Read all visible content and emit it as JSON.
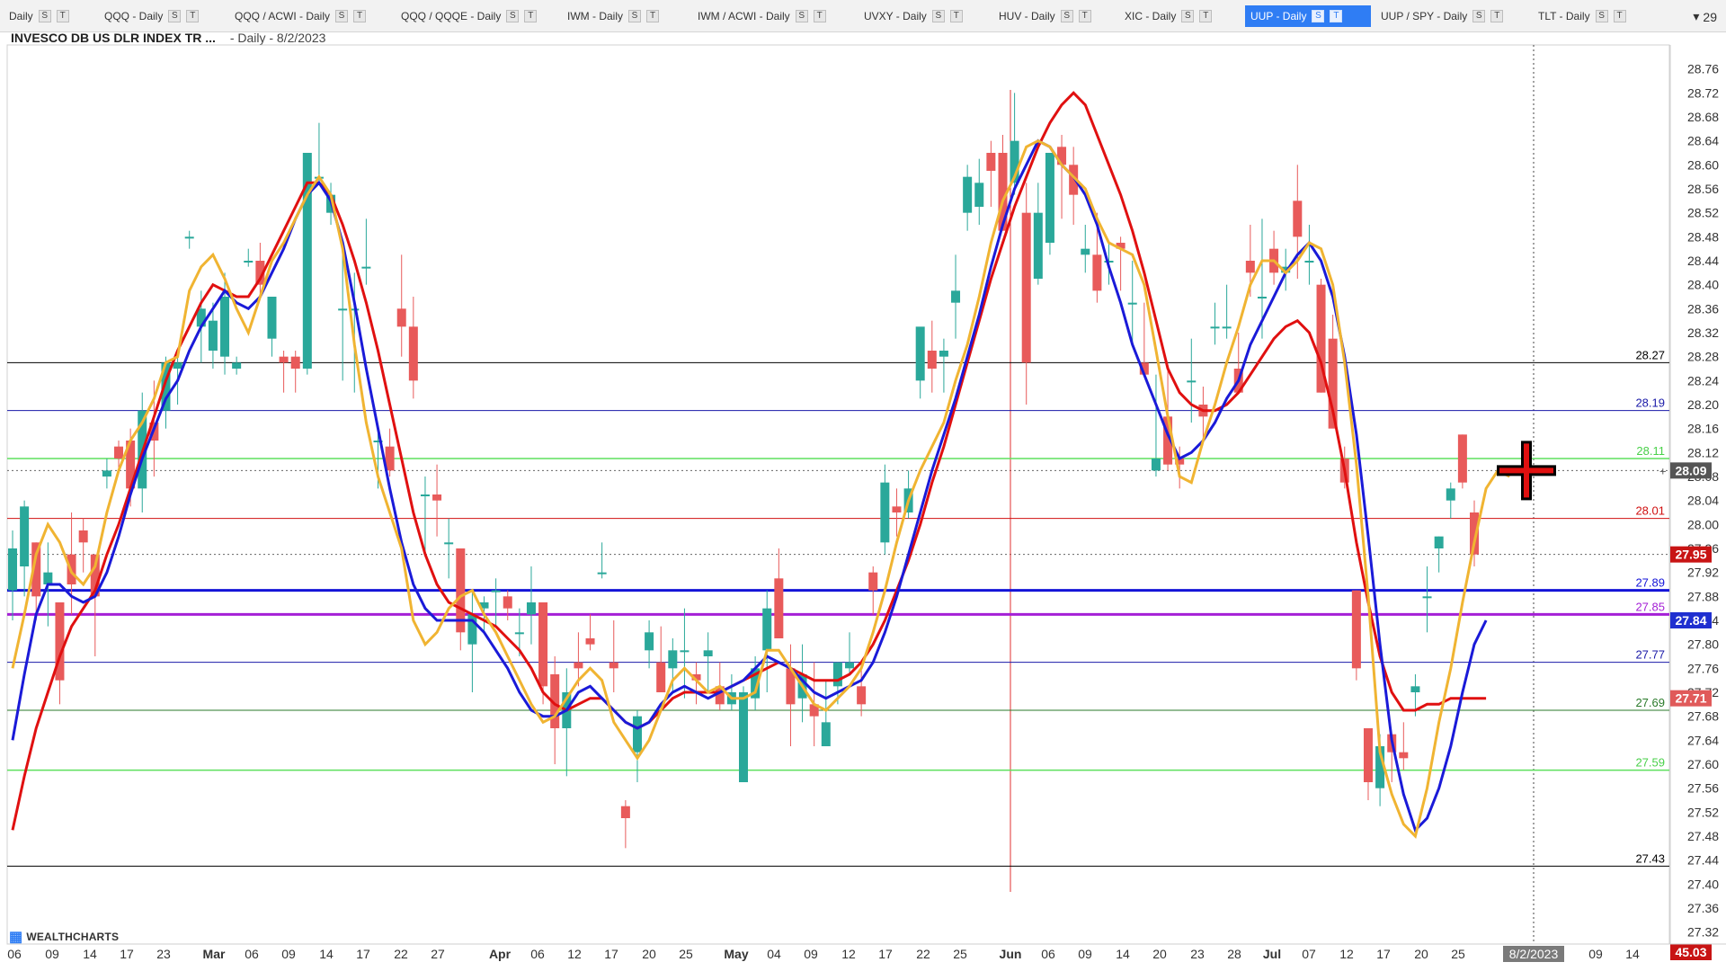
{
  "tabs": [
    {
      "label": "Daily",
      "active": false
    },
    {
      "label": "QQQ - Daily",
      "active": false
    },
    {
      "label": "QQQ / ACWI - Daily",
      "active": false
    },
    {
      "label": "QQQ / QQQE - Daily",
      "active": false
    },
    {
      "label": "IWM - Daily",
      "active": false
    },
    {
      "label": "IWM / ACWI - Daily",
      "active": false
    },
    {
      "label": "UVXY - Daily",
      "active": false
    },
    {
      "label": "HUV - Daily",
      "active": false
    },
    {
      "label": "XIC - Daily",
      "active": false
    },
    {
      "label": "UUP - Daily",
      "active": true
    },
    {
      "label": "UUP / SPY - Daily",
      "active": false
    },
    {
      "label": "TLT - Daily",
      "active": false
    }
  ],
  "tab_buttons": {
    "s": "S",
    "t": "T"
  },
  "tab_more": {
    "icon": "chevron-down-icon",
    "count": "29"
  },
  "title": {
    "symbol": "INVESCO DB US DLR INDEX TR ...",
    "subtitle": "- Daily - 8/2/2023"
  },
  "logo": {
    "text": "WEALTHCHARTS"
  },
  "price_axis": {
    "ticks": [
      "28.76",
      "28.72",
      "28.68",
      "28.64",
      "28.60",
      "28.56",
      "28.52",
      "28.48",
      "28.44",
      "28.40",
      "28.36",
      "28.32",
      "28.28",
      "28.24",
      "28.20",
      "28.16",
      "28.12",
      "28.08",
      "28.04",
      "28.00",
      "27.96",
      "27.92",
      "27.88",
      "27.84",
      "27.80",
      "27.76",
      "27.72",
      "27.68",
      "27.64",
      "27.60",
      "27.56",
      "27.52",
      "27.48",
      "27.44",
      "27.40",
      "27.36",
      "27.32"
    ],
    "badges": [
      {
        "value": "28.09",
        "color": "#555555"
      },
      {
        "value": "27.95",
        "color": "#c81414"
      },
      {
        "value": "27.84",
        "color": "#1f2fd0"
      },
      {
        "value": "27.71",
        "color": "#e05a5a"
      },
      {
        "value": "45.03",
        "color": "#c81414"
      }
    ]
  },
  "horizontal_lines": [
    {
      "label": "28.27",
      "value": 28.27,
      "color": "#000000",
      "width": 1
    },
    {
      "label": "28.19",
      "value": 28.19,
      "color": "#1a1aa8",
      "width": 1
    },
    {
      "label": "28.11",
      "value": 28.11,
      "color": "#5ee05e",
      "width": 1.5
    },
    {
      "label": "28.01",
      "value": 28.01,
      "color": "#d01010",
      "width": 1
    },
    {
      "label": "27.89",
      "value": 27.89,
      "color": "#1414d8",
      "width": 3
    },
    {
      "label": "27.85",
      "value": 27.85,
      "color": "#a41fd6",
      "width": 3
    },
    {
      "label": "27.77",
      "value": 27.77,
      "color": "#1a1aa8",
      "width": 1
    },
    {
      "label": "27.69",
      "value": 27.69,
      "color": "#2a7a2a",
      "width": 1
    },
    {
      "label": "27.59",
      "value": 27.59,
      "color": "#5ee05e",
      "width": 1.5
    },
    {
      "label": "27.43",
      "value": 27.43,
      "color": "#000000",
      "width": 1
    }
  ],
  "x_axis": {
    "labels": [
      "06",
      "09",
      "14",
      "17",
      "23",
      "Mar",
      "06",
      "09",
      "14",
      "17",
      "22",
      "27",
      "Apr",
      "06",
      "12",
      "17",
      "20",
      "25",
      "May",
      "04",
      "09",
      "12",
      "17",
      "22",
      "25",
      "Jun",
      "06",
      "09",
      "14",
      "20",
      "23",
      "28",
      "Jul",
      "07",
      "12",
      "17",
      "20",
      "25",
      "8/2/2023",
      "09",
      "14"
    ]
  },
  "chart_data": {
    "type": "candlestick",
    "ylim": [
      27.3,
      28.8
    ],
    "series_colors": {
      "up": "#2aa89a",
      "down": "#e85a5a",
      "ma_fast": "#f0b432",
      "ma_mid": "#1a1ad8",
      "ma_slow": "#e01010"
    },
    "candles": [
      [
        27.89,
        27.99,
        27.84,
        27.96
      ],
      [
        27.93,
        28.04,
        27.88,
        28.03
      ],
      [
        27.97,
        27.97,
        27.84,
        27.88
      ],
      [
        27.9,
        27.97,
        27.83,
        27.92
      ],
      [
        27.87,
        27.87,
        27.7,
        27.74
      ],
      [
        27.95,
        28.02,
        27.85,
        27.9
      ],
      [
        27.99,
        28.01,
        27.92,
        27.97
      ],
      [
        27.95,
        27.95,
        27.78,
        27.88
      ],
      [
        28.08,
        28.11,
        28.06,
        28.09
      ],
      [
        28.13,
        28.14,
        28.09,
        28.11
      ],
      [
        28.14,
        28.16,
        28.03,
        28.06
      ],
      [
        28.06,
        28.22,
        28.02,
        28.19
      ],
      [
        28.17,
        28.24,
        28.08,
        28.14
      ],
      [
        28.19,
        28.28,
        28.16,
        28.27
      ],
      [
        28.26,
        28.28,
        28.2,
        28.27
      ],
      [
        28.48,
        28.49,
        28.46,
        28.48
      ],
      [
        28.33,
        28.39,
        28.27,
        28.36
      ],
      [
        28.29,
        28.37,
        28.26,
        28.34
      ],
      [
        28.28,
        28.42,
        28.25,
        28.38
      ],
      [
        28.26,
        28.28,
        28.25,
        28.27
      ],
      [
        28.44,
        28.46,
        28.43,
        28.44
      ],
      [
        28.44,
        28.47,
        28.38,
        28.4
      ],
      [
        28.31,
        28.38,
        28.28,
        28.38
      ],
      [
        28.28,
        28.29,
        28.22,
        28.27
      ],
      [
        28.28,
        28.29,
        28.22,
        28.26
      ],
      [
        28.26,
        28.62,
        28.25,
        28.62
      ],
      [
        28.58,
        28.67,
        28.57,
        28.58
      ],
      [
        28.52,
        28.57,
        28.5,
        28.55
      ],
      [
        28.36,
        28.45,
        28.24,
        28.36
      ],
      [
        28.36,
        28.42,
        28.22,
        28.36
      ],
      [
        28.43,
        28.51,
        28.4,
        28.43
      ],
      [
        28.14,
        28.16,
        28.06,
        28.14
      ],
      [
        28.13,
        28.16,
        28.08,
        28.09
      ],
      [
        28.36,
        28.45,
        28.28,
        28.33
      ],
      [
        28.33,
        28.38,
        28.21,
        28.24
      ],
      [
        28.05,
        28.08,
        27.95,
        28.05
      ],
      [
        28.05,
        28.1,
        27.98,
        28.04
      ],
      [
        27.97,
        28.01,
        27.91,
        27.97
      ],
      [
        27.96,
        27.96,
        27.79,
        27.82
      ],
      [
        27.8,
        27.89,
        27.72,
        27.85
      ],
      [
        27.86,
        27.88,
        27.82,
        27.87
      ],
      [
        27.89,
        27.91,
        27.83,
        27.89
      ],
      [
        27.88,
        27.89,
        27.84,
        27.86
      ],
      [
        27.82,
        27.86,
        27.78,
        27.82
      ],
      [
        27.85,
        27.93,
        27.8,
        27.87
      ],
      [
        27.87,
        27.87,
        27.7,
        27.73
      ],
      [
        27.75,
        27.78,
        27.6,
        27.66
      ],
      [
        27.66,
        27.76,
        27.58,
        27.72
      ],
      [
        27.77,
        27.82,
        27.73,
        27.76
      ],
      [
        27.81,
        27.85,
        27.79,
        27.8
      ],
      [
        27.92,
        27.97,
        27.91,
        27.92
      ],
      [
        27.77,
        27.84,
        27.72,
        27.76
      ],
      [
        27.53,
        27.54,
        27.46,
        27.51
      ],
      [
        27.62,
        27.69,
        27.57,
        27.68
      ],
      [
        27.79,
        27.84,
        27.76,
        27.82
      ],
      [
        27.77,
        27.83,
        27.74,
        27.72
      ],
      [
        27.76,
        27.81,
        27.72,
        27.79
      ],
      [
        27.79,
        27.86,
        27.71,
        27.79
      ],
      [
        27.75,
        27.77,
        27.7,
        27.74
      ],
      [
        27.78,
        27.82,
        27.72,
        27.79
      ],
      [
        27.73,
        27.77,
        27.69,
        27.7
      ],
      [
        27.7,
        27.75,
        27.69,
        27.72
      ],
      [
        27.57,
        27.73,
        27.57,
        27.72
      ],
      [
        27.71,
        27.78,
        27.69,
        27.76
      ],
      [
        27.79,
        27.89,
        27.72,
        27.86
      ],
      [
        27.91,
        27.96,
        27.85,
        27.81
      ],
      [
        27.76,
        27.8,
        27.63,
        27.7
      ],
      [
        27.71,
        27.8,
        27.67,
        27.75
      ],
      [
        27.7,
        27.77,
        27.63,
        27.68
      ],
      [
        27.63,
        27.74,
        27.63,
        27.67
      ],
      [
        27.73,
        27.77,
        27.7,
        27.77
      ],
      [
        27.76,
        27.82,
        27.75,
        27.77
      ],
      [
        27.73,
        27.77,
        27.68,
        27.7
      ],
      [
        27.92,
        27.93,
        27.85,
        27.89
      ],
      [
        27.97,
        28.1,
        27.95,
        28.07
      ],
      [
        28.03,
        28.06,
        27.98,
        28.02
      ],
      [
        28.02,
        28.09,
        28.01,
        28.06
      ],
      [
        28.24,
        28.32,
        28.21,
        28.33
      ],
      [
        28.29,
        28.34,
        28.22,
        28.26
      ],
      [
        28.28,
        28.31,
        28.22,
        28.29
      ],
      [
        28.37,
        28.45,
        28.31,
        28.39
      ],
      [
        28.52,
        28.6,
        28.49,
        28.58
      ],
      [
        28.53,
        28.61,
        28.5,
        28.57
      ],
      [
        28.62,
        28.64,
        28.53,
        28.59
      ],
      [
        28.62,
        28.65,
        28.49,
        28.49
      ],
      [
        28.57,
        28.72,
        28.55,
        28.64
      ],
      [
        28.52,
        28.57,
        28.2,
        28.27
      ],
      [
        28.41,
        28.57,
        28.4,
        28.52
      ],
      [
        28.47,
        28.62,
        28.45,
        28.62
      ],
      [
        28.63,
        28.65,
        28.51,
        28.6
      ],
      [
        28.6,
        28.63,
        28.5,
        28.55
      ],
      [
        28.45,
        28.5,
        28.42,
        28.46
      ],
      [
        28.45,
        28.52,
        28.37,
        28.39
      ],
      [
        28.44,
        28.47,
        28.4,
        28.44
      ],
      [
        28.47,
        28.48,
        28.39,
        28.46
      ],
      [
        28.37,
        28.44,
        28.3,
        28.37
      ],
      [
        28.27,
        28.37,
        28.25,
        28.25
      ],
      [
        28.09,
        28.25,
        28.08,
        28.11
      ],
      [
        28.18,
        28.26,
        28.09,
        28.1
      ],
      [
        28.11,
        28.13,
        28.06,
        28.1
      ],
      [
        28.24,
        28.31,
        28.17,
        28.24
      ],
      [
        28.2,
        28.23,
        28.14,
        28.18
      ],
      [
        28.33,
        28.37,
        28.3,
        28.33
      ],
      [
        28.33,
        28.4,
        28.31,
        28.33
      ],
      [
        28.26,
        28.32,
        28.23,
        28.22
      ],
      [
        28.44,
        28.5,
        28.38,
        28.42
      ],
      [
        28.38,
        28.51,
        28.31,
        28.38
      ],
      [
        28.46,
        28.49,
        28.4,
        28.42
      ],
      [
        28.42,
        28.46,
        28.39,
        28.43
      ],
      [
        28.54,
        28.6,
        28.41,
        28.48
      ],
      [
        28.44,
        28.5,
        28.4,
        28.44
      ],
      [
        28.4,
        28.41,
        28.22,
        28.22
      ],
      [
        28.31,
        28.35,
        28.17,
        28.16
      ],
      [
        28.11,
        28.13,
        28.06,
        28.07
      ],
      [
        27.89,
        27.89,
        27.74,
        27.76
      ],
      [
        27.66,
        27.66,
        27.54,
        27.57
      ],
      [
        27.56,
        27.65,
        27.53,
        27.63
      ],
      [
        27.65,
        27.65,
        27.57,
        27.62
      ],
      [
        27.62,
        27.67,
        27.59,
        27.61
      ],
      [
        27.72,
        27.75,
        27.68,
        27.73
      ],
      [
        27.88,
        27.93,
        27.82,
        27.88
      ],
      [
        27.96,
        27.98,
        27.92,
        27.98
      ],
      [
        28.04,
        28.07,
        28.01,
        28.06
      ],
      [
        28.15,
        28.15,
        28.06,
        28.07
      ],
      [
        28.02,
        28.04,
        27.93,
        27.95
      ]
    ],
    "ma_fast": [
      27.76,
      27.85,
      27.95,
      28.0,
      27.97,
      27.92,
      27.9,
      27.93,
      28.02,
      28.09,
      28.14,
      28.17,
      28.21,
      28.27,
      28.28,
      28.39,
      28.43,
      28.45,
      28.41,
      28.36,
      28.32,
      28.38,
      28.44,
      28.47,
      28.51,
      28.55,
      28.58,
      28.55,
      28.46,
      28.3,
      28.17,
      28.08,
      28.02,
      27.96,
      27.84,
      27.8,
      27.82,
      27.86,
      27.88,
      27.89,
      27.85,
      27.82,
      27.78,
      27.74,
      27.7,
      27.67,
      27.68,
      27.71,
      27.74,
      27.76,
      27.74,
      27.67,
      27.64,
      27.61,
      27.64,
      27.69,
      27.74,
      27.76,
      27.74,
      27.72,
      27.73,
      27.71,
      27.71,
      27.72,
      27.79,
      27.79,
      27.76,
      27.73,
      27.7,
      27.69,
      27.71,
      27.73,
      27.76,
      27.82,
      27.89,
      27.97,
      28.04,
      28.09,
      28.13,
      28.17,
      28.24,
      28.3,
      28.38,
      28.47,
      28.54,
      28.58,
      28.63,
      28.64,
      28.63,
      28.6,
      28.58,
      28.56,
      28.51,
      28.47,
      28.46,
      28.45,
      28.4,
      28.29,
      28.18,
      28.08,
      28.07,
      28.14,
      28.2,
      28.27,
      28.33,
      28.4,
      28.44,
      28.44,
      28.42,
      28.44,
      28.47,
      28.46,
      28.4,
      28.27,
      28.1,
      27.88,
      27.62,
      27.55,
      27.5,
      27.48,
      27.56,
      27.67,
      27.76,
      27.87,
      27.97,
      28.06,
      28.09,
      28.08
    ],
    "ma_mid": [
      27.64,
      27.75,
      27.85,
      27.9,
      27.9,
      27.88,
      27.87,
      27.88,
      27.92,
      27.98,
      28.05,
      28.11,
      28.16,
      28.21,
      28.24,
      28.29,
      28.33,
      28.36,
      28.39,
      28.37,
      28.36,
      28.38,
      28.42,
      28.46,
      28.51,
      28.55,
      28.57,
      28.54,
      28.47,
      28.37,
      28.26,
      28.16,
      28.06,
      27.97,
      27.9,
      27.86,
      27.84,
      27.84,
      27.84,
      27.84,
      27.82,
      27.79,
      27.76,
      27.72,
      27.69,
      27.68,
      27.68,
      27.69,
      27.72,
      27.73,
      27.71,
      27.69,
      27.67,
      27.66,
      27.67,
      27.7,
      27.72,
      27.73,
      27.72,
      27.71,
      27.72,
      27.73,
      27.74,
      27.76,
      27.78,
      27.77,
      27.76,
      27.74,
      27.72,
      27.71,
      27.72,
      27.73,
      27.74,
      27.77,
      27.82,
      27.88,
      27.95,
      28.02,
      28.09,
      28.15,
      28.21,
      28.28,
      28.35,
      28.43,
      28.5,
      28.56,
      28.6,
      28.64,
      28.63,
      28.6,
      28.58,
      28.55,
      28.5,
      28.43,
      28.37,
      28.3,
      28.25,
      28.2,
      28.15,
      28.11,
      28.12,
      28.14,
      28.17,
      28.21,
      28.24,
      28.3,
      28.34,
      28.38,
      28.42,
      28.45,
      28.47,
      28.44,
      28.38,
      28.28,
      28.15,
      27.98,
      27.8,
      27.64,
      27.55,
      27.49,
      27.51,
      27.56,
      27.63,
      27.72,
      27.8,
      27.84
    ],
    "ma_slow": [
      27.49,
      27.58,
      27.66,
      27.72,
      27.78,
      27.83,
      27.86,
      27.89,
      27.95,
      28.0,
      28.06,
      28.12,
      28.18,
      28.24,
      28.29,
      28.33,
      28.37,
      28.4,
      28.39,
      28.38,
      28.38,
      28.41,
      28.45,
      28.49,
      28.53,
      28.57,
      28.57,
      28.55,
      28.5,
      28.44,
      28.37,
      28.29,
      28.2,
      28.11,
      28.02,
      27.95,
      27.9,
      27.87,
      27.86,
      27.85,
      27.84,
      27.83,
      27.81,
      27.79,
      27.76,
      27.72,
      27.7,
      27.69,
      27.7,
      27.71,
      27.71,
      27.69,
      27.67,
      27.66,
      27.67,
      27.69,
      27.71,
      27.72,
      27.72,
      27.72,
      27.72,
      27.73,
      27.74,
      27.75,
      27.76,
      27.77,
      27.76,
      27.75,
      27.74,
      27.74,
      27.74,
      27.75,
      27.77,
      27.8,
      27.84,
      27.89,
      27.94,
      28.0,
      28.07,
      28.13,
      28.2,
      28.27,
      28.34,
      28.41,
      28.47,
      28.53,
      28.58,
      28.63,
      28.67,
      28.7,
      28.72,
      28.7,
      28.65,
      28.6,
      28.55,
      28.49,
      28.42,
      28.34,
      28.26,
      28.22,
      28.2,
      28.19,
      28.19,
      28.2,
      28.22,
      28.25,
      28.28,
      28.31,
      28.33,
      28.34,
      28.32,
      28.27,
      28.19,
      28.09,
      27.97,
      27.87,
      27.78,
      27.72,
      27.69,
      27.69,
      27.7,
      27.7,
      27.71,
      27.71,
      27.71,
      27.71
    ]
  },
  "crosshair": {
    "label": "8/2/2023",
    "value": "28.09"
  }
}
